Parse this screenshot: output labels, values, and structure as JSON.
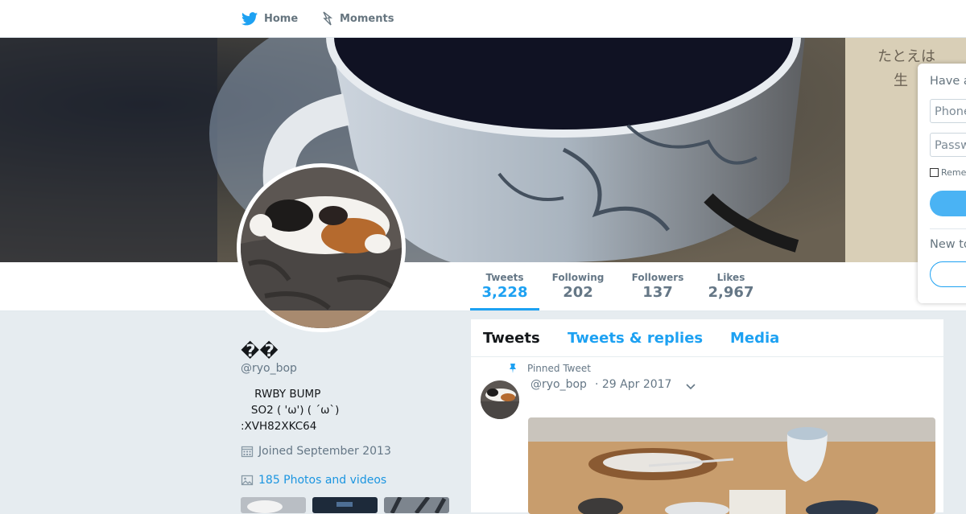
{
  "nav": {
    "home_label": "Home",
    "moments_label": "Moments"
  },
  "profile": {
    "name": "��",
    "handle": "@ryo_bop",
    "bio": "    RWBY BUMP\n   SO2 ( 'ω') ( ´ω`)\n:XVH82XKC64",
    "joined": "Joined September 2013",
    "photos_link": "185 Photos and videos"
  },
  "stats": [
    {
      "label": "Tweets",
      "value": "3,228",
      "active": true
    },
    {
      "label": "Following",
      "value": "202",
      "active": false
    },
    {
      "label": "Followers",
      "value": "137",
      "active": false
    },
    {
      "label": "Likes",
      "value": "2,967",
      "active": false
    }
  ],
  "timeline": {
    "tabs": [
      "Tweets",
      "Tweets & replies",
      "Media"
    ],
    "pinned_label": "Pinned Tweet",
    "tweet": {
      "handle": "@ryo_bop",
      "date": "· 29 Apr 2017"
    }
  },
  "login": {
    "title": "Have a",
    "phone_placeholder": "Phone",
    "password_placeholder": "Passw",
    "remember_label": "Reme",
    "new_label": "New to"
  },
  "colors": {
    "accent": "#1da1f2",
    "page_bg": "#e6ecf0"
  },
  "icons": [
    "twitter-bird-icon",
    "moments-bolt-icon",
    "calendar-icon",
    "photo-icon",
    "pin-icon",
    "chevron-down-icon"
  ]
}
